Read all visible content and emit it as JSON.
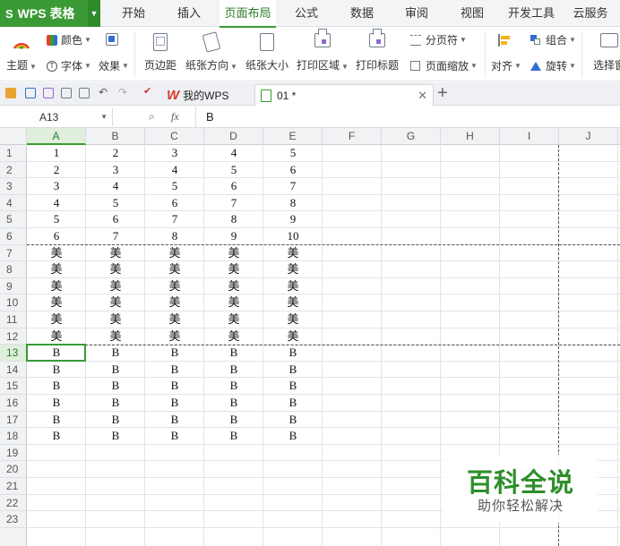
{
  "app": {
    "name": "WPS 表格",
    "logo": "S"
  },
  "menu_tabs": [
    {
      "label": "开始",
      "active": false
    },
    {
      "label": "插入",
      "active": false
    },
    {
      "label": "页面布局",
      "active": true
    },
    {
      "label": "公式",
      "active": false
    },
    {
      "label": "数据",
      "active": false
    },
    {
      "label": "审阅",
      "active": false
    },
    {
      "label": "视图",
      "active": false
    },
    {
      "label": "开发工具",
      "active": false
    },
    {
      "label": "云服务",
      "active": false
    }
  ],
  "ribbon": {
    "theme": "主题",
    "color": "颜色",
    "font": "字体",
    "effect": "效果",
    "margins": "页边距",
    "orientation": "纸张方向",
    "size": "纸张大小",
    "print_area": "打印区域",
    "print_titles": "打印标题",
    "page_break": "分页符",
    "page_zoom": "页面缩放",
    "group": "组合",
    "align": "对齐",
    "rotate": "旋转",
    "select_pane": "选择窗"
  },
  "doc_tabs": [
    {
      "label": "我的WPS",
      "active": false
    },
    {
      "label": "01 *",
      "active": true
    }
  ],
  "formula_bar": {
    "cell_ref": "A13",
    "fx": "fx",
    "value": "B"
  },
  "columns": [
    "A",
    "B",
    "C",
    "D",
    "E",
    "F",
    "G",
    "H",
    "I",
    "J"
  ],
  "selected_column": "A",
  "rows": [
    1,
    2,
    3,
    4,
    5,
    6,
    7,
    8,
    9,
    10,
    11,
    12,
    13,
    14,
    15,
    16,
    17,
    18,
    19,
    20,
    21,
    22,
    23
  ],
  "selected_row": 13,
  "cell_data": [
    [
      "1",
      "2",
      "3",
      "4",
      "5"
    ],
    [
      "2",
      "3",
      "4",
      "5",
      "6"
    ],
    [
      "3",
      "4",
      "5",
      "6",
      "7"
    ],
    [
      "4",
      "5",
      "6",
      "7",
      "8"
    ],
    [
      "5",
      "6",
      "7",
      "8",
      "9"
    ],
    [
      "6",
      "7",
      "8",
      "9",
      "10"
    ],
    [
      "美",
      "美",
      "美",
      "美",
      "美"
    ],
    [
      "美",
      "美",
      "美",
      "美",
      "美"
    ],
    [
      "美",
      "美",
      "美",
      "美",
      "美"
    ],
    [
      "美",
      "美",
      "美",
      "美",
      "美"
    ],
    [
      "美",
      "美",
      "美",
      "美",
      "美"
    ],
    [
      "美",
      "美",
      "美",
      "美",
      "美"
    ],
    [
      "B",
      "B",
      "B",
      "B",
      "B"
    ],
    [
      "B",
      "B",
      "B",
      "B",
      "B"
    ],
    [
      "B",
      "B",
      "B",
      "B",
      "B"
    ],
    [
      "B",
      "B",
      "B",
      "B",
      "B"
    ],
    [
      "B",
      "B",
      "B",
      "B",
      "B"
    ],
    [
      "B",
      "B",
      "B",
      "B",
      "B"
    ]
  ],
  "watermark": {
    "title": "百科全说",
    "subtitle": "助你轻松解决"
  },
  "colors": {
    "accent": "#3a9a35",
    "watermark_green": "#2f8e2b"
  }
}
